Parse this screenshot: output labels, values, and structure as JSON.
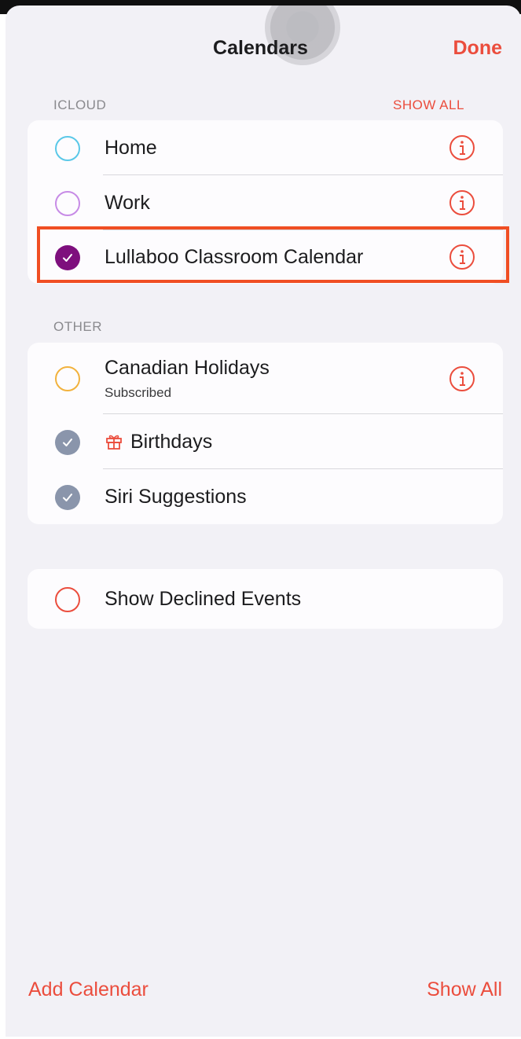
{
  "header": {
    "title": "Calendars",
    "done_label": "Done"
  },
  "icloud": {
    "section_label": "ICLOUD",
    "show_all_label": "SHOW ALL",
    "items": [
      {
        "label": "Home",
        "color": "#5ac8e8",
        "checked": false
      },
      {
        "label": "Work",
        "color": "#c78be6",
        "checked": false
      },
      {
        "label": "Lullaboo Classroom Calendar",
        "color": "#7e0f7d",
        "checked": true
      }
    ]
  },
  "other": {
    "section_label": "OTHER",
    "items": [
      {
        "label": "Canadian Holidays",
        "sublabel": "Subscribed",
        "color": "#f2b23d",
        "checked": false
      },
      {
        "label": "Birthdays",
        "icon": "gift-icon",
        "color": "#8a95ab",
        "checked": true
      },
      {
        "label": "Siri Suggestions",
        "color": "#8a95ab",
        "checked": true
      }
    ]
  },
  "declined": {
    "label": "Show Declined Events",
    "color": "#eb4d3d",
    "checked": false
  },
  "footer": {
    "add_calendar_label": "Add Calendar",
    "show_all_label": "Show All"
  },
  "colors": {
    "accent": "#eb4d3d",
    "highlight_box": "#f04e23",
    "background": "#f2f1f6"
  }
}
